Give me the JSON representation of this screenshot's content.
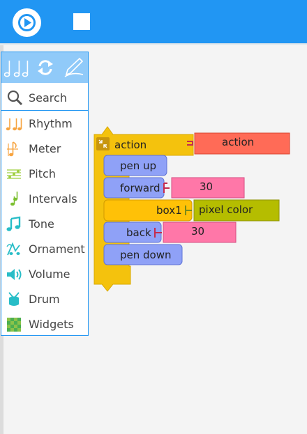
{
  "toolbar": {
    "play_icon": "play-icon",
    "stop_icon": "stop-icon",
    "color": "#2196f3"
  },
  "palette": {
    "header_icons": [
      "rhythm-notes-icon",
      "rhythm-notes-icon",
      "refresh-icon",
      "pen-icon"
    ],
    "search_label": "Search",
    "items": [
      {
        "label": "Rhythm",
        "icon": "rhythm-notes-icon",
        "color": "#f7a440"
      },
      {
        "label": "Meter",
        "icon": "meter-icon",
        "color": "#f7a440"
      },
      {
        "label": "Pitch",
        "icon": "pitch-staff-icon",
        "color": "#9fcf3f"
      },
      {
        "label": "Intervals",
        "icon": "intervals-icon",
        "color": "#7bbf2f"
      },
      {
        "label": "Tone",
        "icon": "tone-note-icon",
        "color": "#28bdc7"
      },
      {
        "label": "Ornament",
        "icon": "ornament-icon",
        "color": "#28bdc7"
      },
      {
        "label": "Volume",
        "icon": "volume-icon",
        "color": "#28bdc7"
      },
      {
        "label": "Drum",
        "icon": "drum-icon",
        "color": "#28bdc7"
      },
      {
        "label": "Widgets",
        "icon": "widgets-grid-icon",
        "color": "#5cb85c"
      }
    ]
  },
  "program": {
    "action_block": {
      "label": "action",
      "name_value": "action",
      "color": "#f4c20d"
    },
    "pen_up": {
      "label": "pen up",
      "color": "#8fa1f7"
    },
    "forward": {
      "label": "forward",
      "value": "30"
    },
    "box_block": {
      "label": "box1",
      "value": "pixel color",
      "color": "#ffc107"
    },
    "back": {
      "label": "back",
      "value": "30"
    },
    "pen_down": {
      "label": "pen down"
    }
  }
}
